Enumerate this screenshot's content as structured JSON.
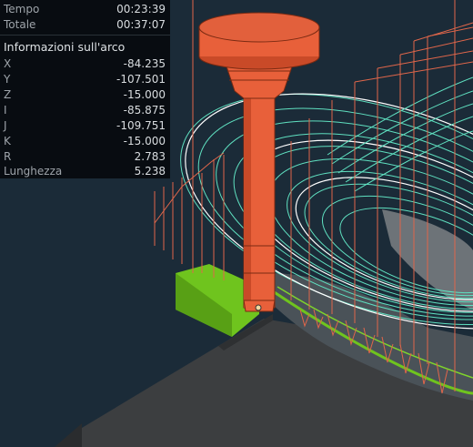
{
  "time": {
    "elapsed_label": "Tempo",
    "elapsed_value": "00:23:39",
    "total_label": "Totale",
    "total_value": "00:37:07"
  },
  "arc_info": {
    "title": "Informazioni sull'arco",
    "rows": [
      {
        "label": "X",
        "value": "-84.235"
      },
      {
        "label": "Y",
        "value": "-107.501"
      },
      {
        "label": "Z",
        "value": "-15.000"
      },
      {
        "label": "I",
        "value": "-85.875"
      },
      {
        "label": "J",
        "value": "-109.751"
      },
      {
        "label": "K",
        "value": "-15.000"
      },
      {
        "label": "R",
        "value": "2.783"
      },
      {
        "label": "Lunghezza",
        "value": "5.238"
      }
    ]
  },
  "colors": {
    "background": "#1b2b38",
    "toolpath_rapid": "#e0664a",
    "toolpath_cut": "#5fe0c0",
    "toolpath_active": "#ffffff",
    "machined_surface": "#6fc41e",
    "tool_body": "#e8603a",
    "stock": "#3a3c3e"
  }
}
